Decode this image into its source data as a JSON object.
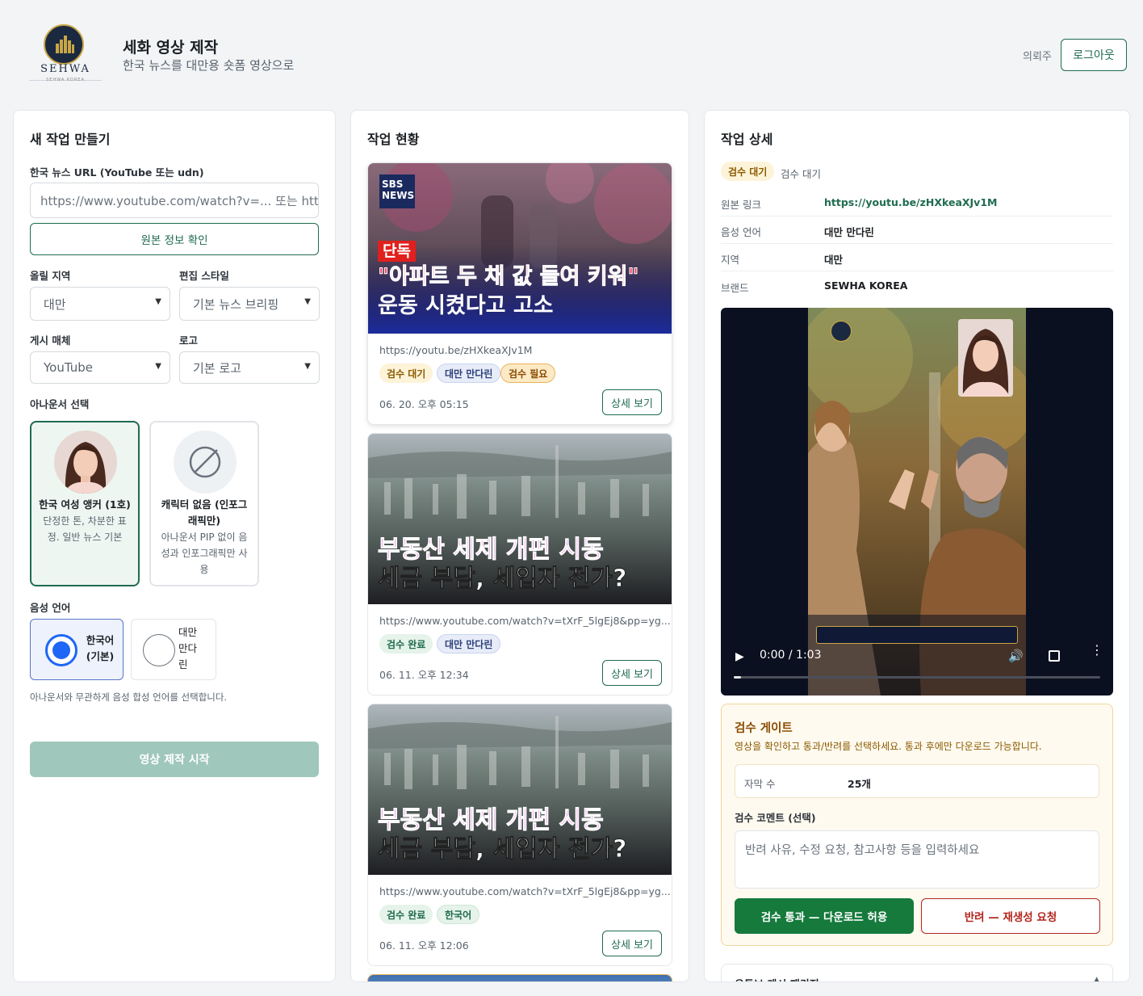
{
  "header": {
    "logo_text": "SEHWA",
    "logo_subtext": "SEHWA KOREA",
    "title": "세화 영상 제작",
    "subtitle": "한국 뉴스를 대만용 숏폼 영상으로",
    "role": "의뢰주",
    "logout_label": "로그아웃"
  },
  "create": {
    "title": "새 작업 만들기",
    "url_label": "한국 뉴스 URL (YouTube 또는 udn)",
    "url_placeholder": "https://www.youtube.com/watch?v=... 또는 https://udn.com/news/...",
    "check_button": "원본 정보 확인",
    "region_label": "올릴 지역",
    "region_value": "대만",
    "style_label": "편집 스타일",
    "style_value": "기본 뉴스 브리핑",
    "platform_label": "게시 매체",
    "platform_value": "YouTube",
    "logo_label": "로고",
    "logo_value": "기본 로고",
    "anchor_label": "아나운서 선택",
    "anchors": [
      {
        "name": "한국 여성 앵커 (1호)",
        "desc": "단정한 톤, 차분한 표정. 일반 뉴스 기본",
        "selected": true
      },
      {
        "name": "캐릭터 없음 (인포그래픽만)",
        "desc": "아나운서 PIP 없이 음성과 인포그래픽만 사용",
        "selected": false
      }
    ],
    "voice_label": "음성 언어",
    "voices": [
      {
        "label": "한국어 (기본)",
        "selected": true
      },
      {
        "label": "대만 만다린",
        "selected": false
      }
    ],
    "voice_hint": "아나운서와 무관하게 음성 합성 언어를 선택합니다.",
    "start_button": "영상 제작 시작"
  },
  "status": {
    "title": "작업 현황",
    "jobs": [
      {
        "thumb_tag": "단독",
        "thumb_line1": "\"아파트 두 채 값 들여 키워\"",
        "thumb_line2": "운동 시켰다고 고소",
        "channel": "SBS NEWS",
        "url": "https://youtu.be/zHXkeaXJv1M",
        "badges": [
          "검수 대기",
          "대만 만다린",
          "검수 필요"
        ],
        "date": "06. 20. 오후 05:15",
        "detail": "상세 보기"
      },
      {
        "thumb_line1": "부동산 세제 개편 시동",
        "thumb_line2": "세금 부담, 세입자 전가?",
        "url": "https://www.youtube.com/watch?v=tXrF_5lgEj8&pp=yg...",
        "badges": [
          "검수 완료",
          "대만 만다린"
        ],
        "date": "06. 11. 오후 12:34",
        "detail": "상세 보기"
      },
      {
        "thumb_line1": "부동산 세제 개편 시동",
        "thumb_line2": "세금 부담, 세입자 전가?",
        "url": "https://www.youtube.com/watch?v=tXrF_5lgEj8&pp=yg...",
        "badges": [
          "검수 완료",
          "한국어"
        ],
        "date": "06. 11. 오후 12:06",
        "detail": "상세 보기"
      }
    ]
  },
  "detail": {
    "title": "작업 상세",
    "status_badge": "검수 대기",
    "status_text": "검수 대기",
    "rows": [
      {
        "key": "원본 링크",
        "value": "https://youtu.be/zHXkeaXJv1M"
      },
      {
        "key": "음성 언어",
        "value": "대만 만다린"
      },
      {
        "key": "지역",
        "value": "대만"
      },
      {
        "key": "브랜드",
        "value": "SEWHA KOREA"
      }
    ],
    "video": {
      "time": "0:00 / 1:03",
      "progress": 0.02
    },
    "gate": {
      "title": "검수 게이트",
      "desc": "영상을 확인하고 통과/반려를 선택하세요. 통과 후에만 다운로드 가능합니다.",
      "caption_key": "자막 수",
      "caption_value": "25개",
      "comment_label": "검수 코멘트 (선택)",
      "comment_placeholder": "반려 사유, 수정 요청, 참고사항 등을 입력하세요",
      "approve": "검수 통과 — 다운로드 허용",
      "reject": "반려 — 재생성 요청"
    },
    "package_title": "유튜브 게시 패키지"
  },
  "colors": {
    "accent": "#1f6b4f",
    "start_disabled": "#9fc7bb",
    "gate_title": "#8a4b00",
    "reject": "#b3261e"
  }
}
